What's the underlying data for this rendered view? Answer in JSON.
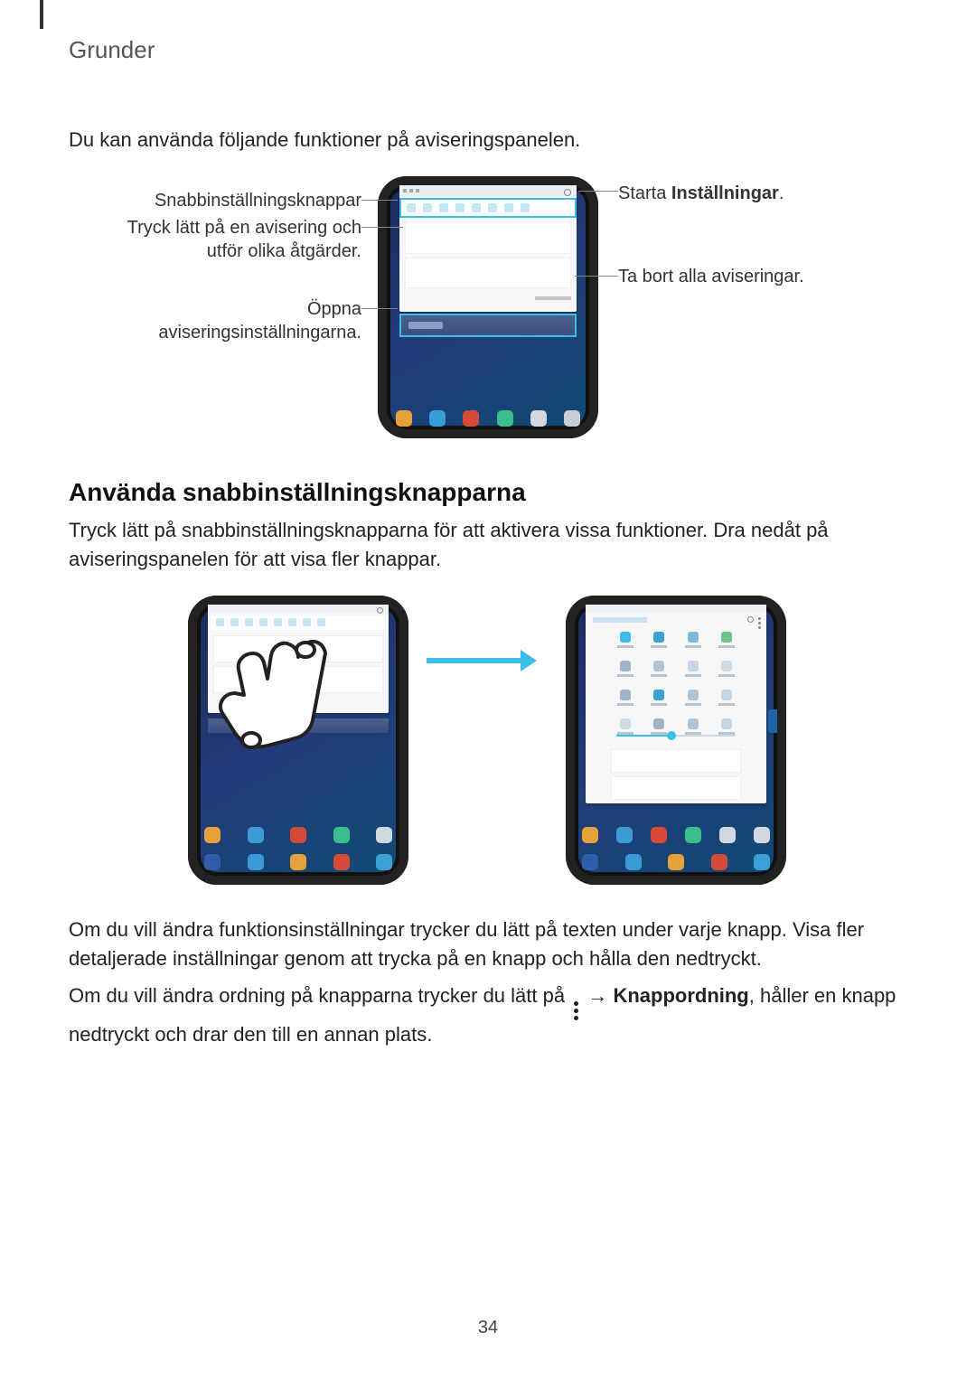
{
  "header": {
    "section": "Grunder"
  },
  "intro": "Du kan använda följande funktioner på aviseringspanelen.",
  "fig1": {
    "callouts": {
      "quick_settings": "Snabbinställningsknappar",
      "tap_notification_l1": "Tryck lätt på en avisering och",
      "tap_notification_l2": "utför olika åtgärder.",
      "open_settings_l1": "Öppna",
      "open_settings_l2": "aviseringsinställningarna.",
      "launch_settings_pre": "Starta ",
      "launch_settings_bold": "Inställningar",
      "launch_settings_post": ".",
      "clear_all": "Ta bort alla aviseringar."
    }
  },
  "section2": {
    "title": "Använda snabbinställningsknapparna",
    "p1": "Tryck lätt på snabbinställningsknapparna för att aktivera vissa funktioner. Dra nedåt på aviseringspanelen för att visa fler knappar."
  },
  "para3": "Om du vill ändra funktionsinställningar trycker du lätt på texten under varje knapp. Visa fler detaljerade inställningar genom att trycka på en knapp och hålla den nedtryckt.",
  "para4": {
    "pre": "Om du vill ändra ordning på knapparna trycker du lätt på ",
    "arrow": " → ",
    "bold": "Knappordning",
    "post": ", håller en knapp nedtryckt och drar den till en annan plats."
  },
  "icons": {
    "more_vertical": "more-vertical-icon"
  },
  "page_number": "34"
}
